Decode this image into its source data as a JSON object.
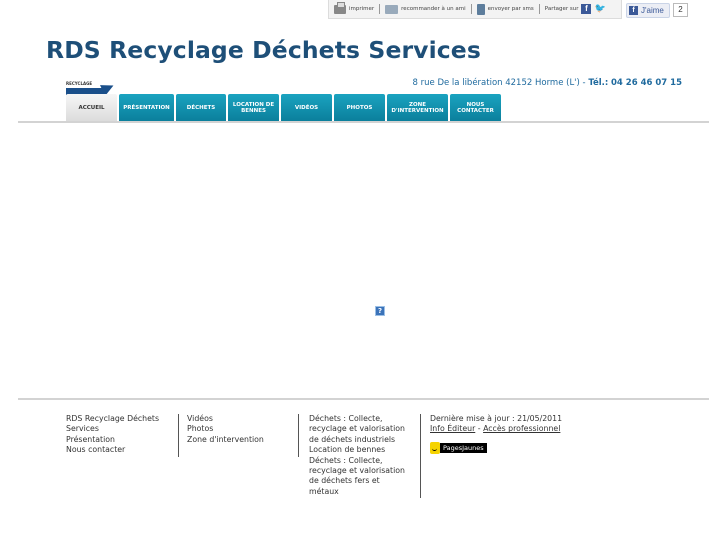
{
  "toolbar": {
    "print": "imprimer",
    "recommend": "recommander à un ami",
    "sms": "envoyer par sms",
    "share": "Partager sur",
    "like": "J'aime",
    "like_count": "2"
  },
  "site": {
    "title": "RDS Recyclage Déchets Services",
    "logo_text": "RECYCLAGE",
    "address": "8 rue De la libération 42152 Horme (L')",
    "address_sep": "-",
    "tel_label": "Tél.:",
    "tel": "04 26 46 07 15"
  },
  "nav": {
    "tabs": [
      {
        "label": "ACCUEIL"
      },
      {
        "label": "PRÉSENTATION"
      },
      {
        "label": "DÉCHETS"
      },
      {
        "label": "LOCATION DE BENNES"
      },
      {
        "label": "VIDÉOS"
      },
      {
        "label": "PHOTOS"
      },
      {
        "label": "ZONE D'INTERVENTION"
      },
      {
        "label": "NOUS CONTACTER"
      }
    ]
  },
  "footer": {
    "col1": [
      "RDS Recyclage Déchets",
      "Services",
      "Présentation",
      "Nous contacter"
    ],
    "col2": [
      "Vidéos",
      "Photos",
      "Zone d'intervention"
    ],
    "col3": [
      "Déchets : Collecte,",
      "recyclage et valorisation",
      "de déchets industriels",
      "Location de bennes",
      "Déchets : Collecte,",
      "recyclage et valorisation",
      "de déchets fers et",
      "métaux"
    ],
    "col4": {
      "updated": "Dernière mise à jour : 21/05/2011",
      "info": "Info Éditeur",
      "dash": "-",
      "pro": "Accès professionnel",
      "pj": "PagesJaunes"
    }
  },
  "colors": {
    "title": "#1e4f78",
    "nav": "#0b7f9c",
    "address": "#1f6a9e"
  }
}
